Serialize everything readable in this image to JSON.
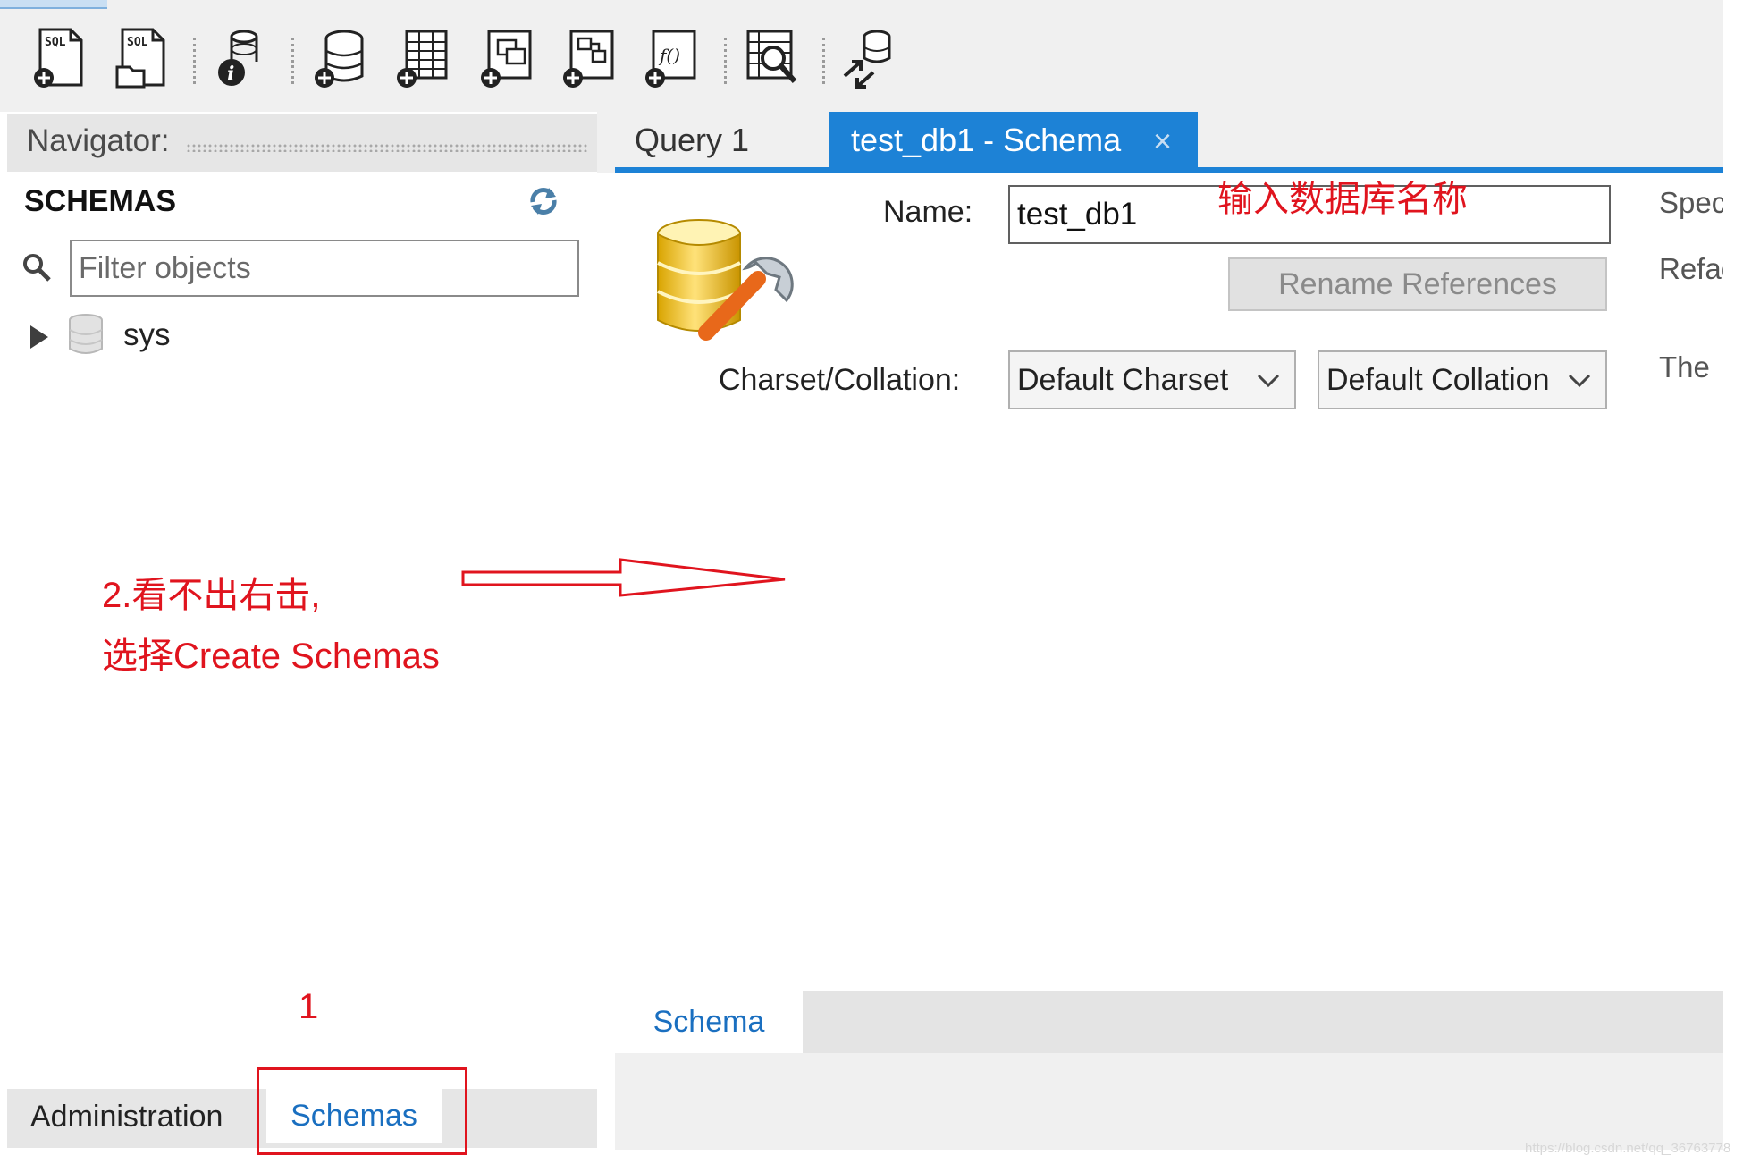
{
  "toolbar": {
    "buttons": [
      {
        "icon": "new-sql-tab-icon",
        "glyph": "SQL"
      },
      {
        "icon": "open-sql-script-icon",
        "glyph": "SQL"
      },
      {
        "icon": "inspector-icon"
      },
      {
        "icon": "create-schema-icon"
      },
      {
        "icon": "create-table-icon"
      },
      {
        "icon": "create-view-icon"
      },
      {
        "icon": "create-procedure-icon"
      },
      {
        "icon": "create-function-icon",
        "glyph": "f()"
      },
      {
        "icon": "search-table-data-icon"
      },
      {
        "icon": "reconnect-icon"
      }
    ]
  },
  "navigator": {
    "title": "Navigator:",
    "section_title": "SCHEMAS",
    "filter_placeholder": "Filter objects",
    "tree": [
      {
        "label": "sys",
        "icon": "database-icon",
        "expanded": false
      }
    ],
    "bottom_tabs": {
      "administration": "Administration",
      "schemas": "Schemas"
    }
  },
  "editor": {
    "tabs": [
      {
        "label": "Query 1",
        "active": false
      },
      {
        "label": "test_db1 - Schema",
        "active": true,
        "close_glyph": "×"
      }
    ],
    "form": {
      "name_label": "Name:",
      "name_value": "test_db1",
      "rename_button": "Rename References",
      "charset_label": "Charset/Collation:",
      "charset_value": "Default Charset",
      "collation_value": "Default Collation"
    },
    "right_cut_text": [
      "Spec",
      "Refac",
      "The"
    ],
    "bottom_tab": "Schema"
  },
  "annotations": {
    "hint_name": "输入数据库名称",
    "step2_line1": "2.看不出右击,",
    "step2_line2": "选择Create Schemas",
    "step1": "1"
  },
  "colors": {
    "accent_blue": "#1d82d6",
    "annotation_red": "#e0141e",
    "panel_gray": "#e6e6e6"
  },
  "watermark": "https://blog.csdn.net/qq_36763778"
}
